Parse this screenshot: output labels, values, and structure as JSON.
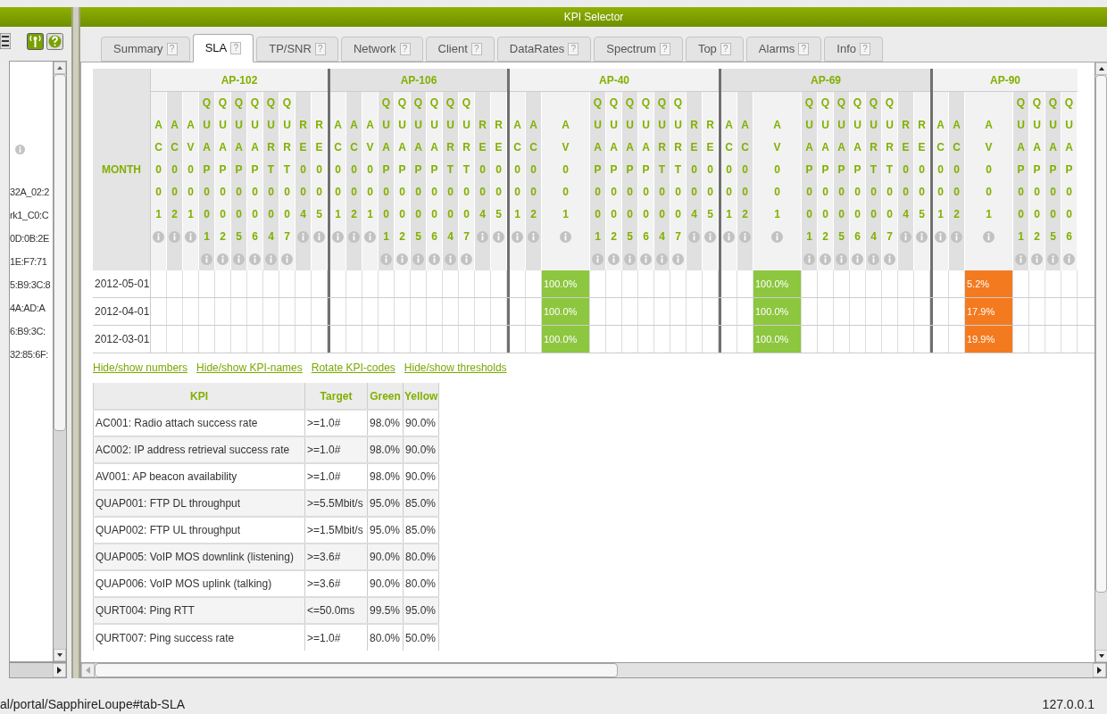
{
  "sidebar": {
    "items": [
      "32A_02:2",
      "rk1_C0:C",
      "0D:0B:2E",
      "1E:F7:71",
      "5:B9:3C:8",
      "4A:AD:A",
      "6:B9:3C:",
      "32:85:6F:"
    ]
  },
  "window": {
    "title": "KPI Selector"
  },
  "tabs": [
    {
      "label": "Summary",
      "help": "?",
      "selected": false
    },
    {
      "label": "SLA",
      "help": "?",
      "selected": true
    },
    {
      "label": "TP/SNR",
      "help": "?",
      "selected": false
    },
    {
      "label": "Network",
      "help": "?",
      "selected": false
    },
    {
      "label": "Client",
      "help": "?",
      "selected": false
    },
    {
      "label": "DataRates",
      "help": "?",
      "selected": false
    },
    {
      "label": "Spectrum",
      "help": "?",
      "selected": false
    },
    {
      "label": "Top",
      "help": "?",
      "selected": false
    },
    {
      "label": "Alarms",
      "help": "?",
      "selected": false
    },
    {
      "label": "Info",
      "help": "?",
      "selected": false
    }
  ],
  "sla_table": {
    "month_header": "MONTH",
    "months": [
      "2012-05-01",
      "2012-04-01",
      "2012-03-01"
    ],
    "groups": [
      {
        "name": "AP-102",
        "columns": [
          {
            "code": "AC001"
          },
          {
            "code": "AC002"
          },
          {
            "code": "AV001"
          },
          {
            "code": "QUAP001"
          },
          {
            "code": "QUAP002"
          },
          {
            "code": "QUAP005"
          },
          {
            "code": "QUAP006"
          },
          {
            "code": "QURT004"
          },
          {
            "code": "QURT007"
          },
          {
            "code": "RE004"
          },
          {
            "code": "RE005"
          }
        ]
      },
      {
        "name": "AP-106",
        "columns": [
          {
            "code": "AC001"
          },
          {
            "code": "AC002"
          },
          {
            "code": "AV001"
          },
          {
            "code": "QUAP001"
          },
          {
            "code": "QUAP002"
          },
          {
            "code": "QUAP005"
          },
          {
            "code": "QUAP006"
          },
          {
            "code": "QURT004"
          },
          {
            "code": "QURT007"
          },
          {
            "code": "RE004"
          },
          {
            "code": "RE005"
          }
        ]
      },
      {
        "name": "AP-40",
        "columns": [
          {
            "code": "AC001"
          },
          {
            "code": "AC002"
          },
          {
            "code": "AV001",
            "cells": [
              {
                "value": "100.0%",
                "color": "#8dc63f"
              },
              {
                "value": "100.0%",
                "color": "#8dc63f"
              },
              {
                "value": "100.0%",
                "color": "#8dc63f"
              }
            ]
          },
          {
            "code": "QUAP001"
          },
          {
            "code": "QUAP002"
          },
          {
            "code": "QUAP005"
          },
          {
            "code": "QUAP006"
          },
          {
            "code": "QURT004"
          },
          {
            "code": "QURT007"
          },
          {
            "code": "RE004"
          },
          {
            "code": "RE005"
          }
        ]
      },
      {
        "name": "AP-69",
        "columns": [
          {
            "code": "AC001"
          },
          {
            "code": "AC002"
          },
          {
            "code": "AV001",
            "cells": [
              {
                "value": "100.0%",
                "color": "#8dc63f"
              },
              {
                "value": "100.0%",
                "color": "#8dc63f"
              },
              {
                "value": "100.0%",
                "color": "#8dc63f"
              }
            ]
          },
          {
            "code": "QUAP001"
          },
          {
            "code": "QUAP002"
          },
          {
            "code": "QUAP005"
          },
          {
            "code": "QUAP006"
          },
          {
            "code": "QURT004"
          },
          {
            "code": "QURT007"
          },
          {
            "code": "RE004"
          },
          {
            "code": "RE005"
          }
        ]
      },
      {
        "name": "AP-90",
        "columns": [
          {
            "code": "AC001"
          },
          {
            "code": "AC002"
          },
          {
            "code": "AV001",
            "cells": [
              {
                "value": "5.2%",
                "color": "#f47a20"
              },
              {
                "value": "17.9%",
                "color": "#f47a20"
              },
              {
                "value": "19.9%",
                "color": "#f47a20"
              }
            ]
          },
          {
            "code": "QUAP001"
          },
          {
            "code": "QUAP002"
          },
          {
            "code": "QUAP005"
          },
          {
            "code": "QUAP006"
          }
        ]
      }
    ]
  },
  "links": [
    "Hide/show numbers",
    "Hide/show KPI-names",
    "Rotate KPI-codes",
    "Hide/show thresholds"
  ],
  "kpi_table": {
    "columns": [
      "KPI",
      "Target",
      "Green",
      "Yellow"
    ],
    "rows": [
      [
        "AC001: Radio attach success rate",
        ">=1.0#",
        "98.0%",
        "90.0%"
      ],
      [
        "AC002: IP address retrieval success rate",
        ">=1.0#",
        "98.0%",
        "90.0%"
      ],
      [
        "AV001: AP beacon availability",
        ">=1.0#",
        "98.0%",
        "90.0%"
      ],
      [
        "QUAP001: FTP DL throughput",
        ">=5.5Mbit/s",
        "95.0%",
        "85.0%"
      ],
      [
        "QUAP002: FTP UL throughput",
        ">=1.5Mbit/s",
        "95.0%",
        "85.0%"
      ],
      [
        "QUAP005: VoIP MOS downlink (listening)",
        ">=3.6#",
        "90.0%",
        "80.0%"
      ],
      [
        "QUAP006: VoIP MOS uplink (talking)",
        ">=3.6#",
        "90.0%",
        "80.0%"
      ],
      [
        "QURT004: Ping RTT",
        "<=50.0ms",
        "99.5%",
        "95.0%"
      ],
      [
        "QURT007: Ping success rate",
        ">=1.0#",
        "80.0%",
        "50.0%"
      ]
    ]
  },
  "status_bar": {
    "url": "al/portal/SapphireLoupe#tab-SLA",
    "host": "127.0.0.1"
  }
}
